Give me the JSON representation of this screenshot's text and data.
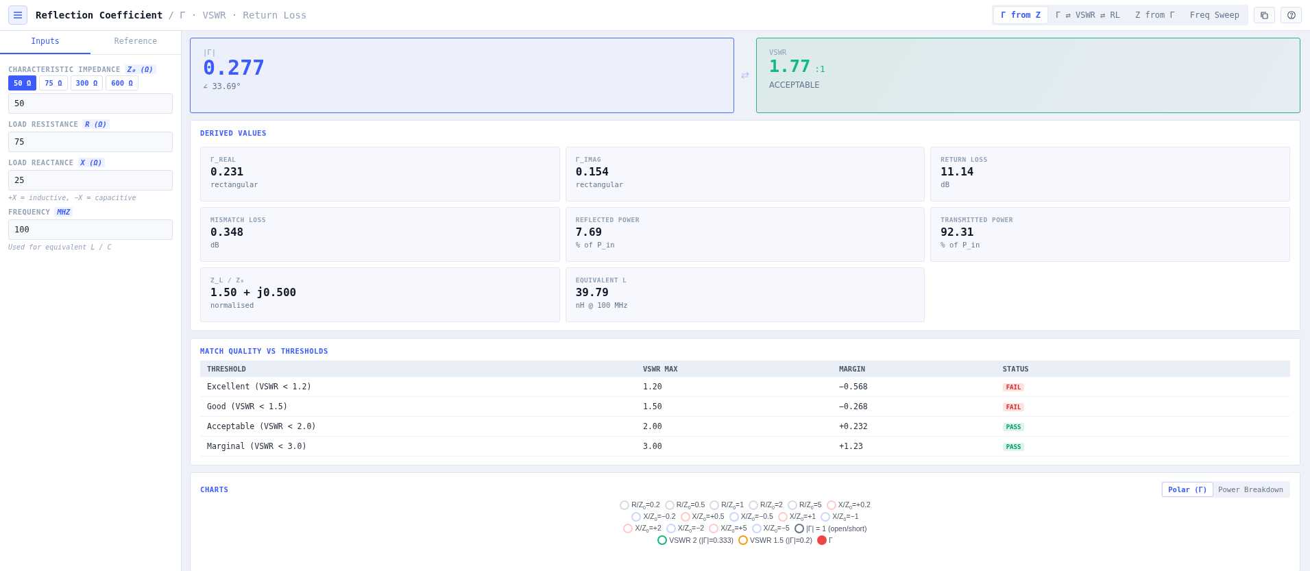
{
  "header": {
    "title": "Reflection Coefficient",
    "separator": "/",
    "breadcrumb": "Γ · VSWR · Return Loss",
    "modes": [
      {
        "label": "Γ from Z",
        "selected": true
      },
      {
        "label": "Γ ⇄ VSWR ⇄ RL",
        "selected": false
      },
      {
        "label": "Z from Γ",
        "selected": false
      },
      {
        "label": "Freq Sweep",
        "selected": false
      }
    ]
  },
  "sidebar": {
    "tabs": [
      {
        "label": "Inputs",
        "selected": true
      },
      {
        "label": "Reference",
        "selected": false
      }
    ],
    "fields": [
      {
        "label": "CHARACTERISTIC IMPEDANCE",
        "unit": "Z₀ (Ω)",
        "presets": [
          {
            "label": "50 Ω",
            "selected": true
          },
          {
            "label": "75 Ω",
            "selected": false
          },
          {
            "label": "300 Ω",
            "selected": false
          },
          {
            "label": "600 Ω",
            "selected": false
          }
        ],
        "value": "50"
      },
      {
        "label": "LOAD RESISTANCE",
        "unit": "R (Ω)",
        "value": "75"
      },
      {
        "label": "LOAD REACTANCE",
        "unit": "X (Ω)",
        "value": "25",
        "hint": "+X = inductive, −X = capacitive"
      },
      {
        "label": "FREQUENCY",
        "unit": "MHZ",
        "value": "100",
        "hint": "Used for equivalent L / C"
      }
    ]
  },
  "gamma_card": {
    "label": "|Γ|",
    "value": "0.277",
    "angle": "∠ 33.69°"
  },
  "vswr_card": {
    "label": "VSWR",
    "value": "1.77",
    "unit": ":1",
    "rating": "ACCEPTABLE"
  },
  "derived": {
    "title": "DERIVED VALUES",
    "items": [
      {
        "label": "Γ_REAL",
        "value": "0.231",
        "note": "rectangular"
      },
      {
        "label": "Γ_IMAG",
        "value": "0.154",
        "note": "rectangular"
      },
      {
        "label": "RETURN LOSS",
        "value": "11.14",
        "note": "dB"
      },
      {
        "label": "MISMATCH LOSS",
        "value": "0.348",
        "note": "dB"
      },
      {
        "label": "REFLECTED POWER",
        "value": "7.69",
        "note": "% of P_in"
      },
      {
        "label": "TRANSMITTED POWER",
        "value": "92.31",
        "note": "% of P_in"
      },
      {
        "label": "Z_L / Z₀",
        "value": "1.50 + j0.500",
        "note": "normalised"
      },
      {
        "label": "EQUIVALENT L",
        "value": "39.79",
        "note": "nH @ 100 MHz"
      }
    ]
  },
  "match": {
    "title": "MATCH QUALITY VS THRESHOLDS",
    "columns": [
      "THRESHOLD",
      "VSWR MAX",
      "MARGIN",
      "STATUS"
    ],
    "rows": [
      {
        "threshold": "Excellent (VSWR < 1.2)",
        "vswr_max": "1.20",
        "margin": "−0.568",
        "status": "FAIL",
        "passed": false
      },
      {
        "threshold": "Good (VSWR < 1.5)",
        "vswr_max": "1.50",
        "margin": "−0.268",
        "status": "FAIL",
        "passed": false
      },
      {
        "threshold": "Acceptable (VSWR < 2.0)",
        "vswr_max": "2.00",
        "margin": "+0.232",
        "status": "PASS",
        "passed": true
      },
      {
        "threshold": "Marginal (VSWR < 3.0)",
        "vswr_max": "3.00",
        "margin": "+1.23",
        "status": "PASS",
        "passed": true
      }
    ]
  },
  "charts": {
    "title": "CHARTS",
    "tabs": [
      {
        "label": "Polar (Γ)",
        "selected": true
      },
      {
        "label": "Power Breakdown",
        "selected": false
      }
    ],
    "legend": [
      [
        {
          "label": "R/Z$_{0}$=0.2",
          "color": "#d5dbe3",
          "kind": "ring"
        },
        {
          "label": "R/Z$_{0}$=0.5",
          "color": "#d5dbe3",
          "kind": "ring"
        },
        {
          "label": "R/Z$_{0}$=1",
          "color": "#d5dbe3",
          "kind": "ring"
        },
        {
          "label": "R/Z$_{0}$=2",
          "color": "#d5dbe3",
          "kind": "ring"
        },
        {
          "label": "R/Z$_{0}$=5",
          "color": "#d5dbe3",
          "kind": "ring"
        },
        {
          "label": "X/Z$_{0}$=+0.2",
          "color": "#fecaca",
          "kind": "ring"
        }
      ],
      [
        {
          "label": "X/Z$_{0}$=−0.2",
          "color": "#c7d7fe",
          "kind": "ring"
        },
        {
          "label": "X/Z$_{0}$=+0.5",
          "color": "#fecaca",
          "kind": "ring"
        },
        {
          "label": "X/Z$_{0}$=−0.5",
          "color": "#c7d7fe",
          "kind": "ring"
        },
        {
          "label": "X/Z$_{0}$=+1",
          "color": "#fecaca",
          "kind": "ring"
        },
        {
          "label": "X/Z$_{0}$=−1",
          "color": "#c7d7fe",
          "kind": "ring"
        }
      ],
      [
        {
          "label": "X/Z$_{0}$=+2",
          "color": "#fecaca",
          "kind": "ring"
        },
        {
          "label": "X/Z$_{0}$=−2",
          "color": "#c7d7fe",
          "kind": "ring"
        },
        {
          "label": "X/Z$_{0}$=+5",
          "color": "#fecaca",
          "kind": "ring"
        },
        {
          "label": "X/Z$_{0}$=−5",
          "color": "#c7d7fe",
          "kind": "ring"
        },
        {
          "label": "|Γ| = 1 (open/short)",
          "color": "#64748b",
          "kind": "ring"
        }
      ],
      [
        {
          "label": "VSWR 2 (|Γ|=0.333)",
          "color": "#10b981",
          "kind": "ring"
        },
        {
          "label": "VSWR 1.5 (|Γ|=0.2)",
          "color": "#f59e0b",
          "kind": "ring"
        },
        {
          "label": "Γ",
          "color": "#ef4444",
          "kind": "dot"
        }
      ]
    ]
  }
}
